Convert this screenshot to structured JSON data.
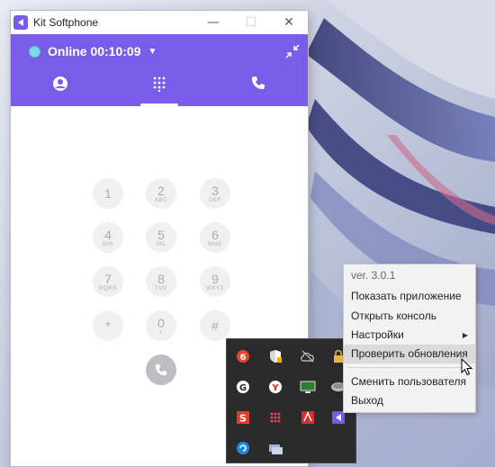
{
  "window": {
    "title": "Kit Softphone",
    "minimize_icon": "minimize-icon",
    "maximize_icon": "maximize-icon",
    "close_icon": "close-icon"
  },
  "status": {
    "text": "Online 00:10:09",
    "color": "#7fd8e6"
  },
  "colors": {
    "brand": "#7b5ce8",
    "key_bg": "#f0f0f1",
    "key_text": "#a9acb3"
  },
  "tabs": [
    {
      "icon": "contact-icon"
    },
    {
      "icon": "dialpad-icon",
      "active": true
    },
    {
      "icon": "phone-icon"
    }
  ],
  "dialpad": {
    "keys": [
      {
        "digit": "1",
        "letters": ""
      },
      {
        "digit": "2",
        "letters": "ABC"
      },
      {
        "digit": "3",
        "letters": "DEF"
      },
      {
        "digit": "4",
        "letters": "GHI"
      },
      {
        "digit": "5",
        "letters": "JKL"
      },
      {
        "digit": "6",
        "letters": "MNO"
      },
      {
        "digit": "7",
        "letters": "PQRS"
      },
      {
        "digit": "8",
        "letters": "TUV"
      },
      {
        "digit": "9",
        "letters": "WXYZ"
      },
      {
        "digit": "*",
        "letters": ""
      },
      {
        "digit": "0",
        "letters": "+"
      },
      {
        "digit": "#",
        "letters": ""
      }
    ]
  },
  "context_menu": {
    "version": "ver. 3.0.1",
    "items": [
      {
        "label": "Показать приложение"
      },
      {
        "label": "Открыть консоль"
      },
      {
        "label": "Настройки",
        "has_submenu": true
      },
      {
        "label": "Проверить обновления",
        "hovered": true
      },
      {
        "label": "Сменить пользователя"
      },
      {
        "label": "Выход"
      }
    ]
  },
  "tray_icons": [
    "app-b-icon",
    "security-shield-icon",
    "cloud-offline-icon",
    "lock-icon",
    "grammarly-icon",
    "yandex-icon",
    "monitor-icon",
    "drive-icon",
    "s-app-icon",
    "dots-app-icon",
    "acrobat-icon",
    "kit-softphone-icon",
    "sync-app-icon",
    "network-icon"
  ]
}
